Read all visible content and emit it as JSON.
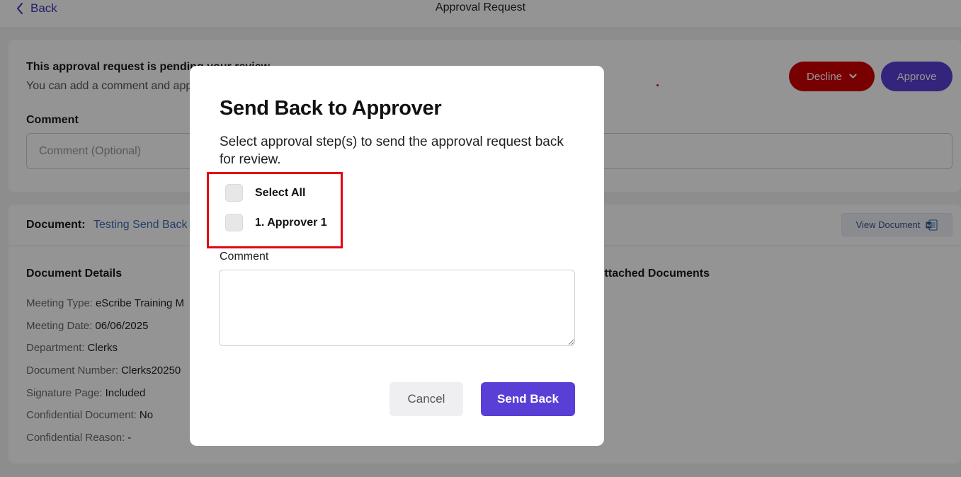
{
  "header": {
    "back_label": "Back",
    "title": "Approval Request"
  },
  "review": {
    "title": "This approval request is pending your review",
    "subtitle": "You can add a comment and approve or decline",
    "comment_label": "Comment",
    "comment_placeholder": "Comment (Optional)",
    "decline_label": "Decline",
    "approve_label": "Approve"
  },
  "document": {
    "label": "Document:",
    "name": "Testing Send Back",
    "view_label": "View Document",
    "details_title": "Document Details",
    "attachments_title": "Attached Documents",
    "details": [
      {
        "label": "Meeting Type:",
        "value": "eScribe Training M"
      },
      {
        "label": "Meeting Date:",
        "value": "06/06/2025"
      },
      {
        "label": "Department:",
        "value": "Clerks"
      },
      {
        "label": "Document Number:",
        "value": "Clerks20250"
      },
      {
        "label": "Signature Page:",
        "value": "Included"
      },
      {
        "label": "Confidential Document:",
        "value": "No"
      },
      {
        "label": "Confidential Reason:",
        "value": "-"
      }
    ]
  },
  "modal": {
    "title": "Send Back to Approver",
    "description": "Select approval step(s) to send the approval request back for review.",
    "options": [
      {
        "label": "Select All",
        "checked": false
      },
      {
        "label": "1. Approver 1",
        "checked": false
      }
    ],
    "comment_label": "Comment",
    "comment_value": "",
    "cancel_label": "Cancel",
    "send_label": "Send Back"
  },
  "colors": {
    "accent": "#5a3fd6",
    "decline": "#d10000",
    "highlight": "#e30613",
    "link": "#3e6fb5"
  }
}
